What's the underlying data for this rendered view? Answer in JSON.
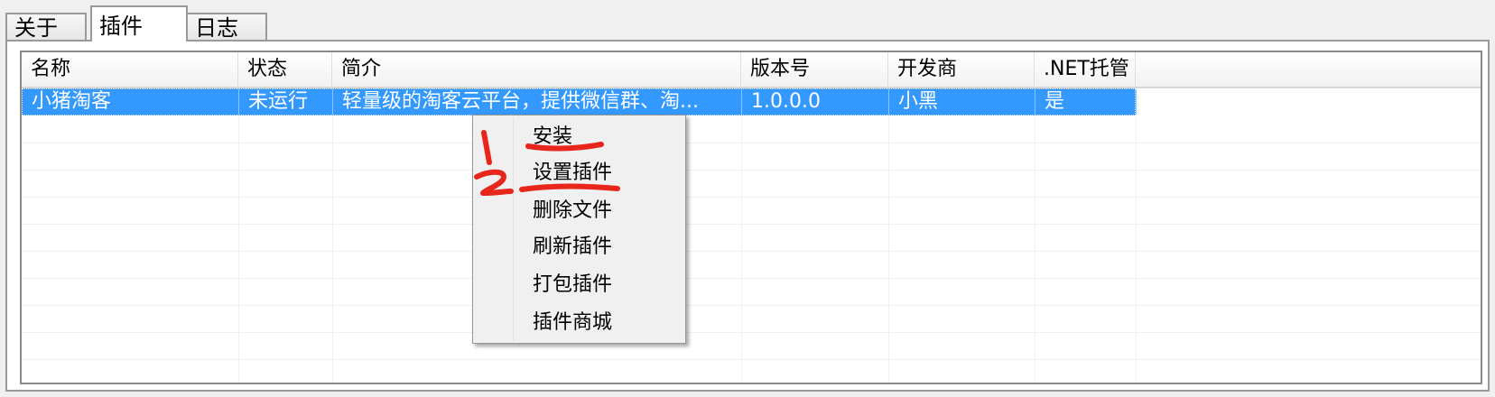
{
  "tabs": [
    {
      "label": "关于"
    },
    {
      "label": "插件",
      "active": true
    },
    {
      "label": "日志"
    }
  ],
  "table": {
    "columns": [
      "名称",
      "状态",
      "简介",
      "版本号",
      "开发商",
      ".NET托管"
    ],
    "rows": [
      [
        "小猪淘客",
        "未运行",
        "轻量级的淘客云平台，提供微信群、淘...",
        "1.0.0.0",
        "小黑",
        "是"
      ]
    ]
  },
  "context_menu": {
    "items": [
      "安装",
      "设置插件",
      "删除文件",
      "刷新插件",
      "打包插件",
      "插件商城"
    ]
  },
  "annotations": {
    "color": "#e8261c",
    "marks": [
      "1",
      "2"
    ]
  },
  "colors": {
    "selection": "#3399ff"
  }
}
